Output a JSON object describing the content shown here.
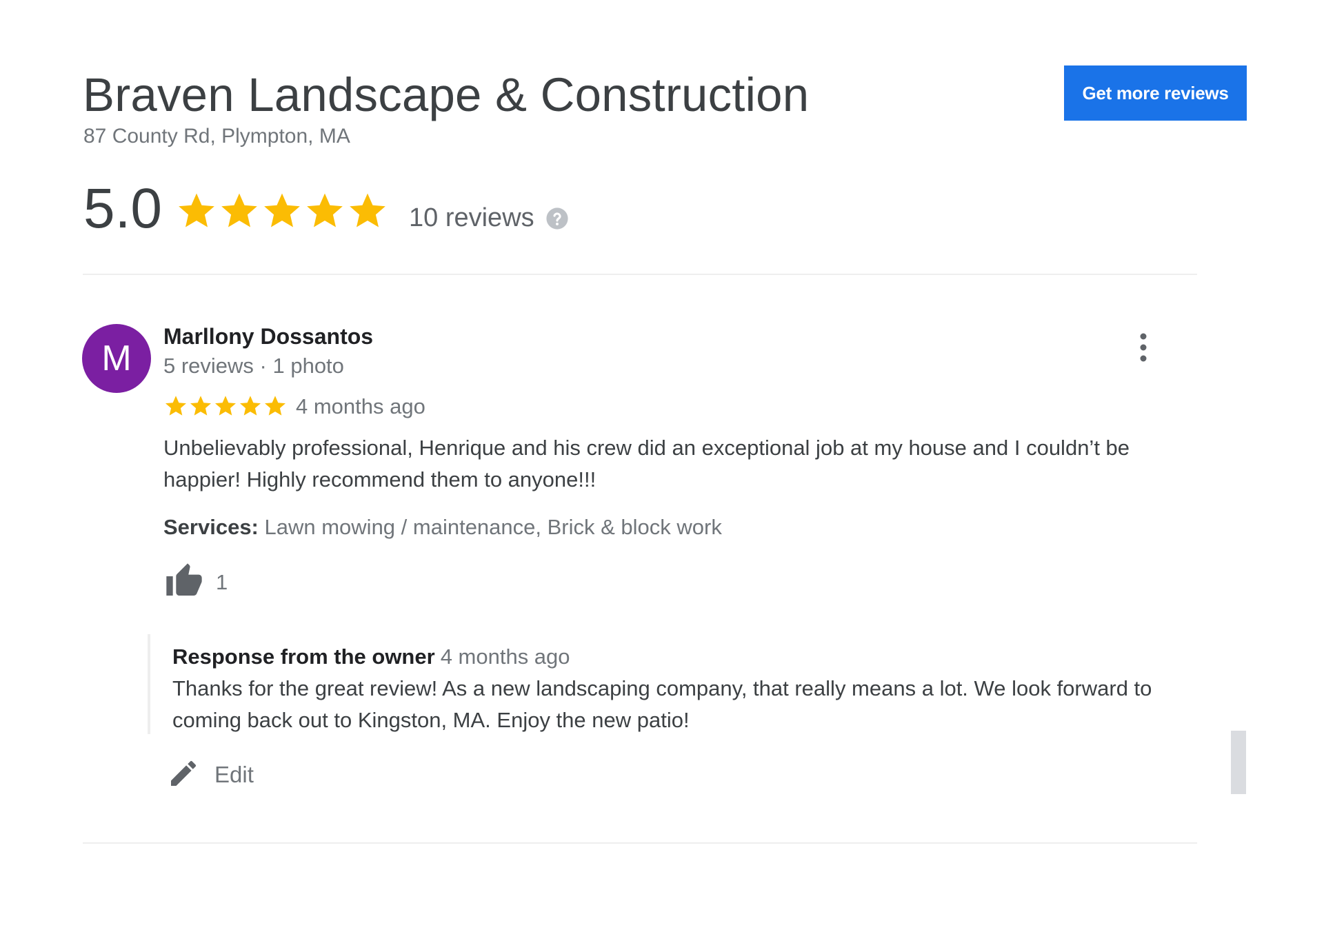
{
  "business": {
    "name": "Braven Landscape & Construction",
    "address": "87 County Rd, Plympton, MA"
  },
  "actions": {
    "get_more_reviews": "Get more reviews"
  },
  "summary": {
    "rating": "5.0",
    "stars": 5,
    "reviews_count": "10 reviews",
    "star_color": "#fbbc04"
  },
  "review": {
    "avatar_letter": "M",
    "avatar_color": "#7b1fa2",
    "reviewer_name": "Marllony Dossantos",
    "reviewer_meta": "5 reviews · 1 photo",
    "stars": 5,
    "date": "4 months ago",
    "text": "Unbelievably professional, Henrique and his crew did an exceptional job at my house and I couldn’t be happier! Highly recommend them to anyone!!!",
    "services_label": "Services:",
    "services_value": " Lawn mowing / maintenance, Brick & block work",
    "likes": "1",
    "response": {
      "label": "Response from the owner",
      "date": "4 months ago",
      "text": "Thanks for the great review! As a new landscaping company, that really means a lot. We look forward to coming back out to Kingston, MA. Enjoy the new patio!"
    },
    "edit_label": "Edit"
  },
  "icons": {
    "help": "help-circle-icon",
    "more": "more-vertical-icon",
    "like": "thumbs-up-icon",
    "edit": "pencil-icon",
    "star": "star-icon"
  },
  "colors": {
    "accent": "#1a73e8"
  }
}
